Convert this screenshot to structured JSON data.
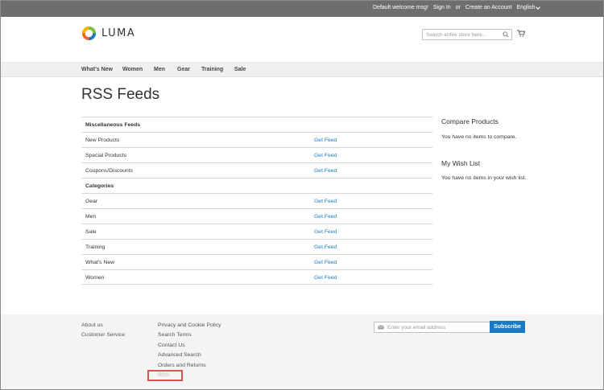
{
  "topbar": {
    "welcome": "Default welcome msg!",
    "sign_in": "Sign In",
    "or": "or",
    "create_account": "Create an Account",
    "language": "English"
  },
  "header": {
    "logo_text": "LUMA",
    "search_placeholder": "Search entire store here...",
    "icons": [
      "search-icon",
      "cart-icon"
    ]
  },
  "nav": {
    "items": [
      "What's New",
      "Women",
      "Men",
      "Gear",
      "Training",
      "Sale"
    ]
  },
  "page": {
    "title": "RSS Feeds"
  },
  "feeds": {
    "misc_header": "Miscellaneous Feeds",
    "categories_header": "Categories",
    "link_text": "Get Feed",
    "misc": [
      "New Products",
      "Special Products",
      "Coupons/Discounts"
    ],
    "categories": [
      "Gear",
      "Men",
      "Sale",
      "Training",
      "What's New",
      "Women"
    ]
  },
  "sidebar": {
    "compare_title": "Compare Products",
    "compare_text": "You have no items to compare.",
    "wishlist_title": "My Wish List",
    "wishlist_text": "You have no items in your wish list."
  },
  "footer": {
    "col1": [
      "About us",
      "Customer Service"
    ],
    "col2": [
      "Privacy and Cookie Policy",
      "Search Terms",
      "Contact Us",
      "Advanced Search",
      "Orders and Returns",
      "RSS"
    ],
    "newsletter_placeholder": "Enter your email address",
    "subscribe_label": "Subscribe"
  },
  "colors": {
    "topbar_bg": "#6e6e6e",
    "link_blue": "#1979c3",
    "highlight_red": "#d9534f",
    "nav_bg": "#f0f0f0",
    "footer_bg": "#f4f4f4"
  }
}
